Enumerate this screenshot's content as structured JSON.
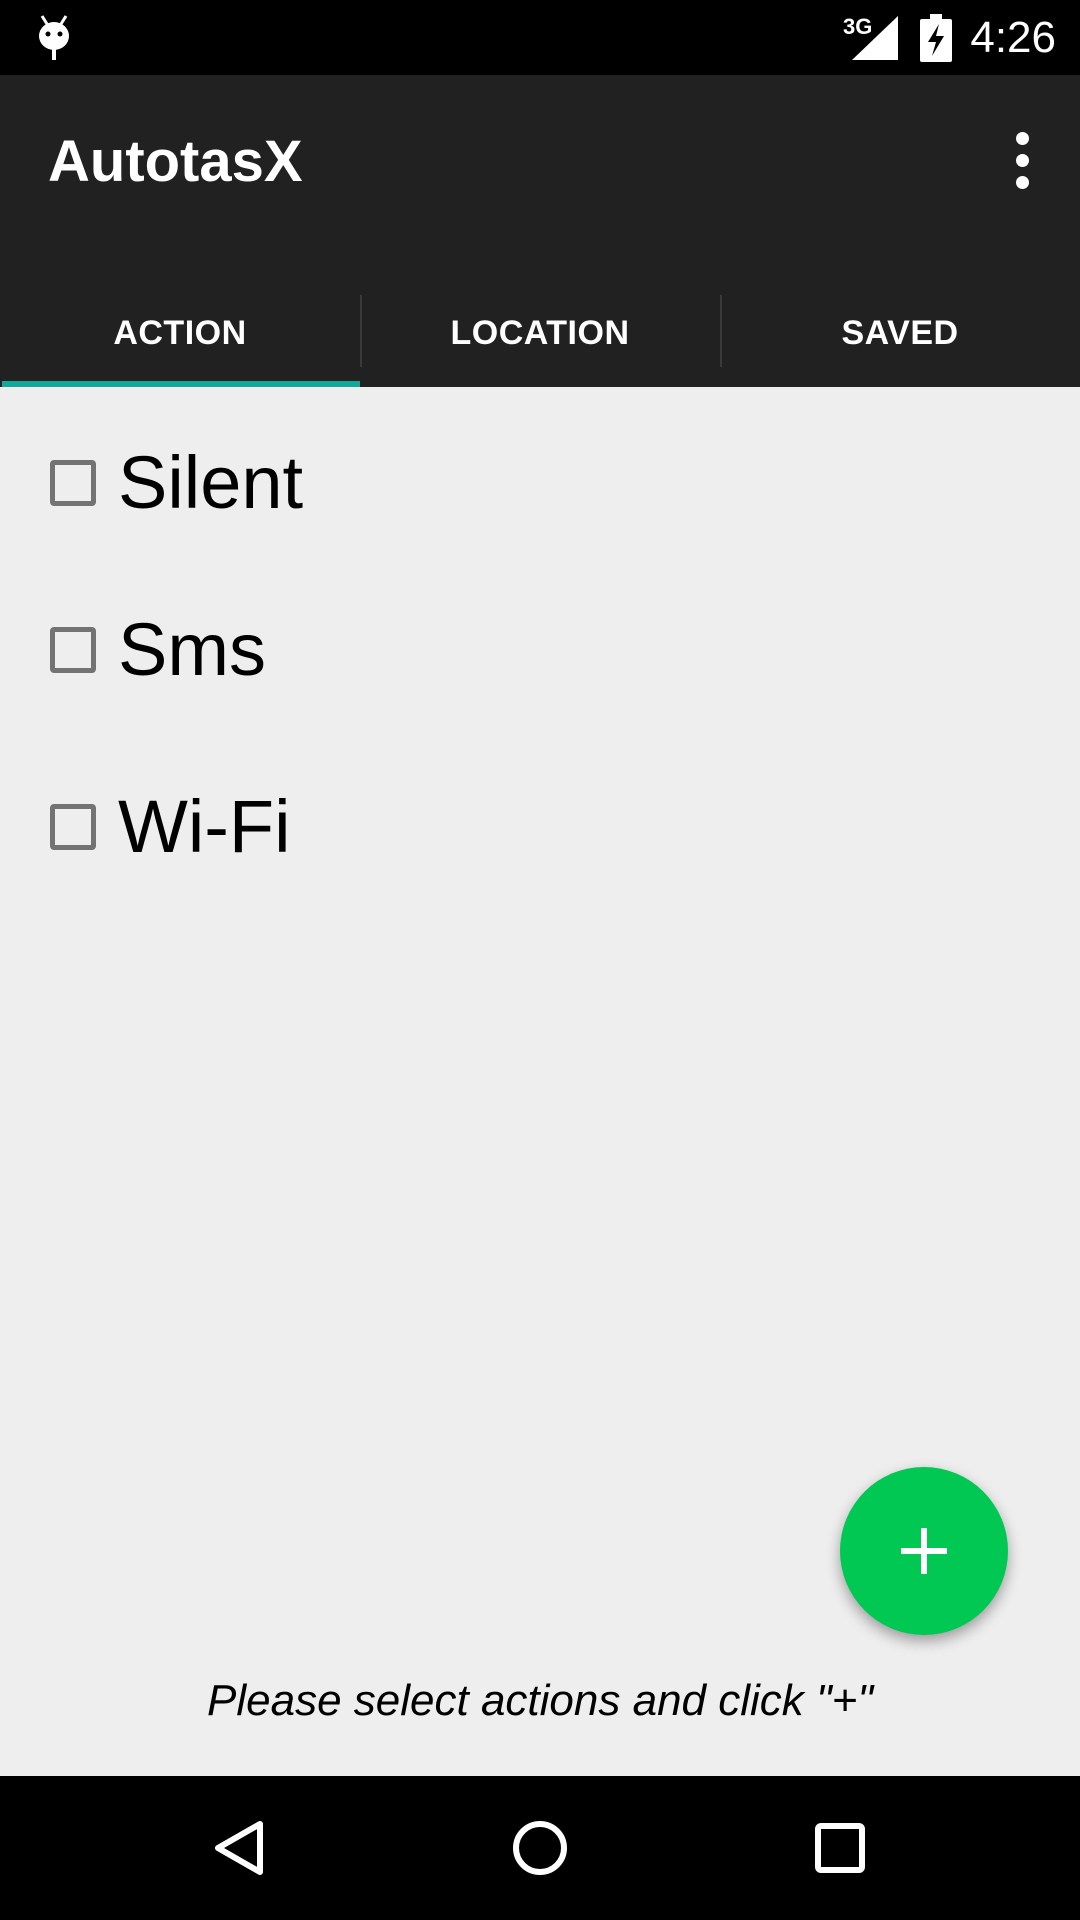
{
  "status_bar": {
    "network": "3G",
    "time": "4:26",
    "icons": [
      "android-debug-icon",
      "signal-icon",
      "battery-charging-icon"
    ]
  },
  "app_bar": {
    "title": "AutotasX",
    "menu_icon": "more-vert-icon"
  },
  "tabs": [
    {
      "label": "ACTION",
      "selected": true
    },
    {
      "label": "LOCATION",
      "selected": false
    },
    {
      "label": "SAVED",
      "selected": false
    }
  ],
  "colors": {
    "tab_indicator": "#14a89a",
    "fab": "#00c853",
    "app_bar": "#212121"
  },
  "options": [
    {
      "label": "Silent",
      "checked": false
    },
    {
      "label": "Sms",
      "checked": false
    },
    {
      "label": "Wi-Fi",
      "checked": false
    }
  ],
  "fab": {
    "icon": "plus-icon"
  },
  "hint": "Please select actions and click \"+\"",
  "nav_bar": {
    "icons": [
      "back-icon",
      "home-icon",
      "recents-icon"
    ]
  }
}
